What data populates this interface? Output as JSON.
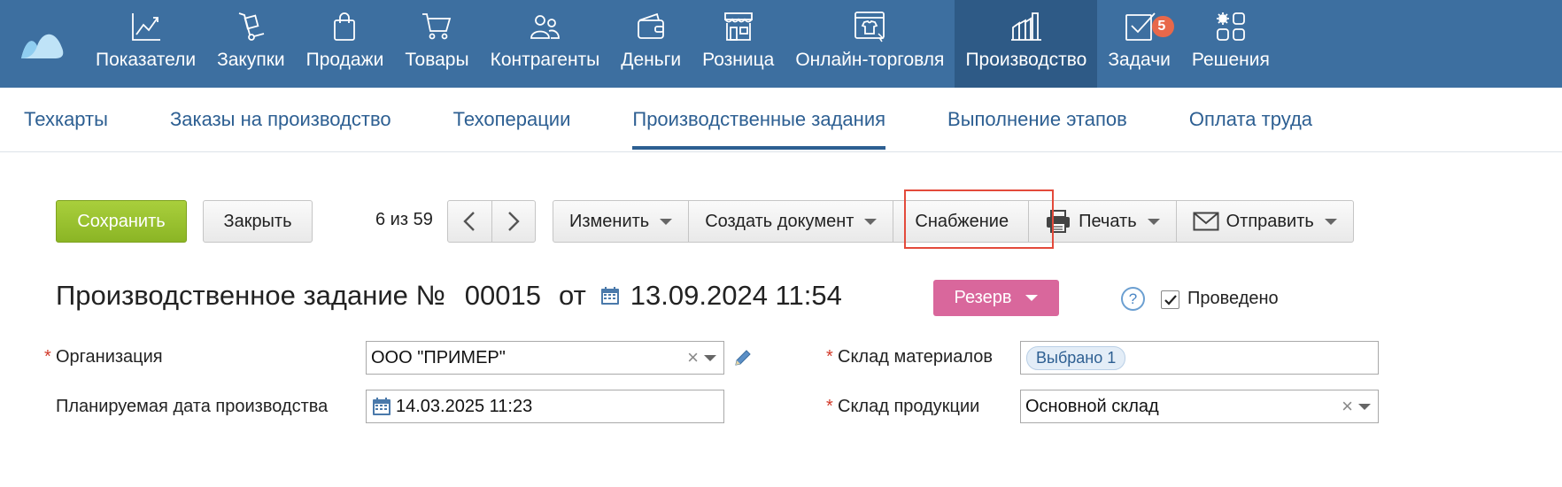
{
  "topnav": {
    "items": [
      {
        "label": "Показатели",
        "icon": "chart-line-icon"
      },
      {
        "label": "Закупки",
        "icon": "hand-truck-icon"
      },
      {
        "label": "Продажи",
        "icon": "shopping-bag-icon"
      },
      {
        "label": "Товары",
        "icon": "cart-icon"
      },
      {
        "label": "Контрагенты",
        "icon": "people-icon"
      },
      {
        "label": "Деньги",
        "icon": "wallet-icon"
      },
      {
        "label": "Розница",
        "icon": "store-icon"
      },
      {
        "label": "Онлайн-торговля",
        "icon": "online-shop-icon"
      },
      {
        "label": "Производство",
        "icon": "factory-icon",
        "active": true
      },
      {
        "label": "Задачи",
        "icon": "task-check-icon",
        "badge": "5"
      },
      {
        "label": "Решения",
        "icon": "apps-grid-icon"
      }
    ]
  },
  "subnav": {
    "items": [
      {
        "label": "Техкарты"
      },
      {
        "label": "Заказы на производство"
      },
      {
        "label": "Техоперации"
      },
      {
        "label": "Производственные задания",
        "active": true
      },
      {
        "label": "Выполнение этапов"
      },
      {
        "label": "Оплата труда"
      }
    ]
  },
  "toolbar": {
    "save_label": "Сохранить",
    "close_label": "Закрыть",
    "counter": "6 из 59",
    "edit_label": "Изменить",
    "create_doc_label": "Создать документ",
    "supply_label": "Снабжение",
    "print_label": "Печать",
    "send_label": "Отправить"
  },
  "document": {
    "title_prefix": "Производственное задание №",
    "number": "00015",
    "date_prefix": "от",
    "datetime": "13.09.2024 11:54",
    "status": "Резерв",
    "status_color": "#d9679c",
    "help": "?",
    "posted_label": "Проведено",
    "posted_checked": true
  },
  "form": {
    "required_mark": "*",
    "org_label": "Организация",
    "org_value": "ООО \"ПРИМЕР\"",
    "plan_date_label": "Планируемая дата производства",
    "plan_date_value": "14.03.2025 11:23",
    "materials_warehouse_label": "Склад материалов",
    "materials_warehouse_chip": "Выбрано 1",
    "product_warehouse_label": "Склад продукции",
    "product_warehouse_value": "Основной склад"
  },
  "colors": {
    "nav_bg": "#3d6fa0",
    "nav_active": "#2e5a86",
    "save_green": "#9cc431",
    "link_blue": "#2d5f92",
    "highlight_red": "#e34a3b"
  }
}
